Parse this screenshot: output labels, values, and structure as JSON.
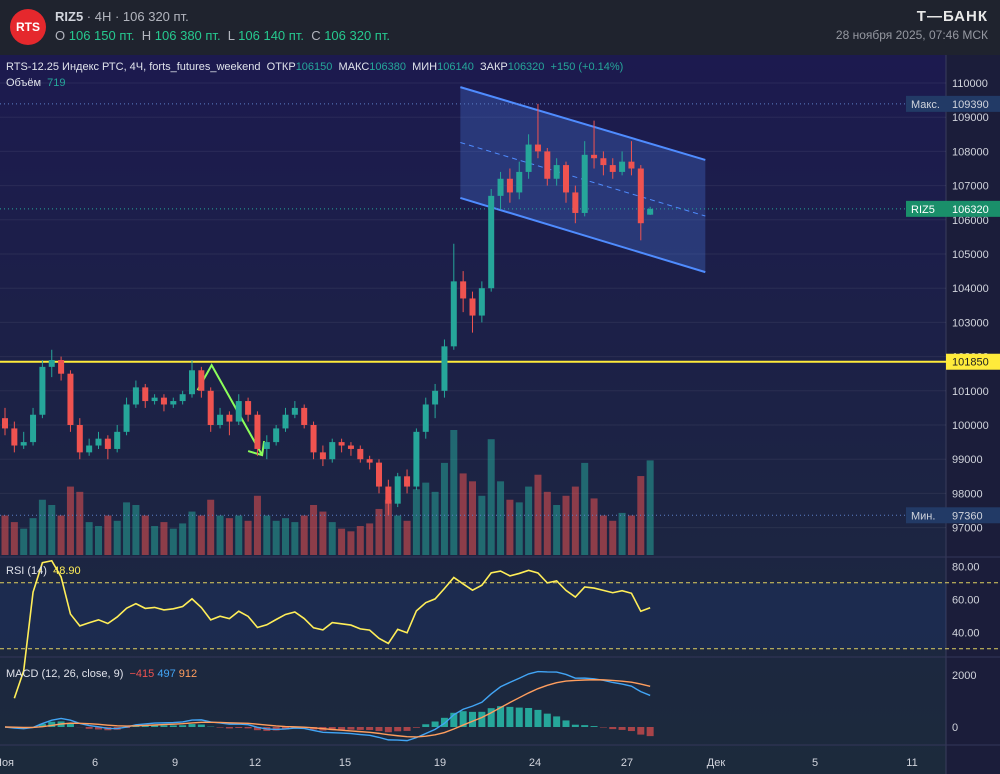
{
  "header": {
    "logo": "RTS",
    "ticker": "RIZ5",
    "interval": "4H",
    "price": "106 320 пт.",
    "ohlc": [
      {
        "k": "O",
        "v": "106 150 пт."
      },
      {
        "k": "H",
        "v": "106 380 пт."
      },
      {
        "k": "L",
        "v": "106 140 пт."
      },
      {
        "k": "C",
        "v": "106 320 пт."
      }
    ],
    "brand": "Т—БАНК",
    "datetime": "28 ноября 2025, 07:46 МСК"
  },
  "legend": {
    "title": "RTS-12.25 Индекс РТС, 4Ч, forts_futures_weekend",
    "open_k": "ОТКР",
    "open": "106150",
    "high_k": "МАКС",
    "high": "106380",
    "low_k": "МИН",
    "low": "106140",
    "close_k": "ЗАКР",
    "close": "106320",
    "change": "+150 (+0.14%)",
    "volume_k": "Объём",
    "volume": "719"
  },
  "colors": {
    "up": "#26a69a",
    "down": "#ef5350",
    "level": "#ffeb3b",
    "channel": "#4f8cff",
    "arrow": "#8cff5a",
    "rsi": "#ffee58",
    "macd": "#42a5f5",
    "signal": "#ff9e5e"
  },
  "chart_data": {
    "type": "candlestick",
    "price_axis": {
      "ticks": [
        97000,
        98000,
        99000,
        100000,
        101000,
        102000,
        103000,
        104000,
        105000,
        106000,
        107000,
        108000,
        109000,
        110000
      ],
      "range": [
        96300,
        110500
      ]
    },
    "labels": {
      "max_k": "Макс.",
      "max": "109390",
      "min_k": "Мин.",
      "min": "97360",
      "last_k": "RIZ5",
      "last": "106320",
      "level": "101850"
    },
    "x_ticks": [
      "Ноя",
      "6",
      "9",
      "12",
      "15",
      "19",
      "24",
      "27",
      "Дек",
      "5",
      "11"
    ],
    "level": 101850,
    "candles": [
      [
        100200,
        100500,
        99700,
        99900,
        300
      ],
      [
        99900,
        100100,
        99200,
        99400,
        250
      ],
      [
        99400,
        99800,
        99300,
        99500,
        200
      ],
      [
        99500,
        100500,
        99400,
        100300,
        280
      ],
      [
        100300,
        101900,
        100200,
        101700,
        420
      ],
      [
        101700,
        102200,
        101400,
        101900,
        380
      ],
      [
        101900,
        102000,
        101300,
        101500,
        300
      ],
      [
        101500,
        101600,
        99800,
        100000,
        520
      ],
      [
        100000,
        100200,
        99000,
        99200,
        480
      ],
      [
        99200,
        99600,
        99100,
        99400,
        250
      ],
      [
        99400,
        99800,
        99300,
        99600,
        220
      ],
      [
        99600,
        99700,
        99000,
        99300,
        300
      ],
      [
        99300,
        100000,
        99200,
        99800,
        260
      ],
      [
        99800,
        100800,
        99700,
        100600,
        400
      ],
      [
        100600,
        101300,
        100500,
        101100,
        380
      ],
      [
        101100,
        101200,
        100500,
        100700,
        300
      ],
      [
        100700,
        100900,
        100600,
        100800,
        220
      ],
      [
        100800,
        100900,
        100400,
        100600,
        250
      ],
      [
        100600,
        100800,
        100500,
        100700,
        200
      ],
      [
        100700,
        101000,
        100600,
        100900,
        240
      ],
      [
        100900,
        101900,
        100800,
        101600,
        330
      ],
      [
        101600,
        101700,
        100800,
        101000,
        300
      ],
      [
        101000,
        101100,
        99800,
        100000,
        420
      ],
      [
        100000,
        100500,
        99900,
        100300,
        300
      ],
      [
        100300,
        100400,
        99700,
        100100,
        280
      ],
      [
        100100,
        100900,
        100000,
        100700,
        300
      ],
      [
        100700,
        100800,
        100100,
        100300,
        260
      ],
      [
        100300,
        100400,
        99100,
        99300,
        450
      ],
      [
        99300,
        99700,
        99000,
        99500,
        300
      ],
      [
        99500,
        100000,
        99400,
        99900,
        260
      ],
      [
        99900,
        100500,
        99800,
        100300,
        280
      ],
      [
        100300,
        100700,
        100200,
        100500,
        250
      ],
      [
        100500,
        100600,
        99900,
        100000,
        300
      ],
      [
        100000,
        100100,
        99000,
        99200,
        380
      ],
      [
        99200,
        99400,
        98800,
        99000,
        330
      ],
      [
        99000,
        99600,
        98900,
        99500,
        250
      ],
      [
        99500,
        99600,
        99200,
        99400,
        200
      ],
      [
        99400,
        99500,
        99100,
        99300,
        180
      ],
      [
        99300,
        99400,
        98900,
        99000,
        220
      ],
      [
        99000,
        99100,
        98700,
        98900,
        240
      ],
      [
        98900,
        99000,
        98000,
        98200,
        350
      ],
      [
        98200,
        98400,
        97360,
        97700,
        420
      ],
      [
        97700,
        98600,
        97600,
        98500,
        300
      ],
      [
        98500,
        98700,
        98000,
        98200,
        260
      ],
      [
        98200,
        99900,
        98100,
        99800,
        500
      ],
      [
        99800,
        100800,
        99600,
        100600,
        550
      ],
      [
        100600,
        101200,
        100200,
        101000,
        480
      ],
      [
        101000,
        102500,
        100800,
        102300,
        700
      ],
      [
        102300,
        105300,
        102200,
        104200,
        950
      ],
      [
        104200,
        104500,
        103300,
        103700,
        620
      ],
      [
        103700,
        103900,
        102700,
        103200,
        560
      ],
      [
        103200,
        104200,
        103000,
        104000,
        450
      ],
      [
        104000,
        106900,
        103900,
        106700,
        880
      ],
      [
        106700,
        107400,
        106300,
        107200,
        560
      ],
      [
        107200,
        107500,
        106500,
        106800,
        420
      ],
      [
        106800,
        107700,
        106600,
        107400,
        400
      ],
      [
        107400,
        108500,
        107200,
        108200,
        520
      ],
      [
        108200,
        109390,
        107800,
        108000,
        610
      ],
      [
        108000,
        108100,
        107000,
        107200,
        480
      ],
      [
        107200,
        107800,
        107000,
        107600,
        380
      ],
      [
        107600,
        107700,
        106500,
        106800,
        450
      ],
      [
        106800,
        107000,
        105900,
        106200,
        520
      ],
      [
        106200,
        108300,
        106100,
        107900,
        700
      ],
      [
        107900,
        108900,
        107500,
        107800,
        430
      ],
      [
        107800,
        108000,
        107300,
        107600,
        300
      ],
      [
        107600,
        107800,
        107200,
        107400,
        260
      ],
      [
        107400,
        108000,
        107300,
        107700,
        320
      ],
      [
        107700,
        108300,
        107300,
        107500,
        300
      ],
      [
        107500,
        107600,
        105400,
        105900,
        600
      ],
      [
        106150,
        106380,
        106140,
        106320,
        719
      ]
    ],
    "channel": {
      "upper": [
        [
          48.7,
          109880
        ],
        [
          74.9,
          107750
        ]
      ],
      "lower": [
        [
          48.7,
          106640
        ],
        [
          74.9,
          104470
        ]
      ]
    },
    "arrow": [
      [
        20.6,
        101020
      ],
      [
        22.1,
        101750
      ],
      [
        27.5,
        99120
      ]
    ],
    "rsi": {
      "label": "RSI (14)",
      "value": "48.90",
      "ticks": [
        "80.00",
        "60.00",
        "40.00"
      ],
      "bands": [
        70,
        30
      ],
      "range": [
        25,
        85
      ]
    },
    "macd": {
      "label": "MACD (12, 26, close, 9)",
      "hist": "−415",
      "macd": "497",
      "signal": "912",
      "ticks": [
        "2000",
        "0"
      ]
    }
  }
}
